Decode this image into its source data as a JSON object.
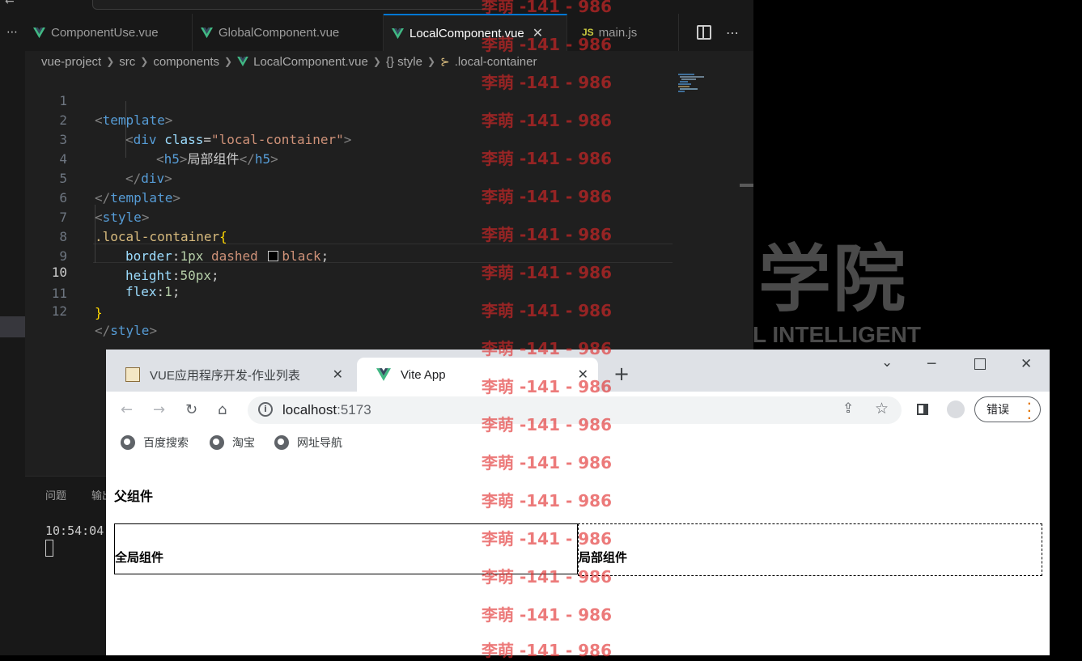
{
  "vscode": {
    "tabs": [
      {
        "label": "ComponentUse.vue",
        "icon": "vue-icon"
      },
      {
        "label": "GlobalComponent.vue",
        "icon": "vue-icon"
      },
      {
        "label": "LocalComponent.vue",
        "icon": "vue-icon",
        "active": true
      },
      {
        "label": "main.js",
        "icon": "js-icon"
      }
    ],
    "js_badge": "JS",
    "breadcrumb": [
      "vue-project",
      "src",
      "components",
      "LocalComponent.vue",
      "{} style",
      ".local-container"
    ],
    "code": {
      "l1": {
        "n": "1",
        "open": "<",
        "tag": "template",
        "close": ">"
      },
      "l2": {
        "n": "2",
        "open": "<",
        "tag": "div",
        "attr": "class",
        "eq": "=",
        "val": "\"local-container\"",
        "close": ">"
      },
      "l3": {
        "n": "3",
        "open": "<",
        "tag": "h5",
        "close": ">",
        "text": "局部组件",
        "open2": "</",
        "tag2": "h5",
        "close2": ">"
      },
      "l4": {
        "n": "4",
        "open": "</",
        "tag": "div",
        "close": ">"
      },
      "l5": {
        "n": "5",
        "open": "</",
        "tag": "template",
        "close": ">"
      },
      "l6": {
        "n": "6",
        "open": "<",
        "tag": "style",
        "close": ">"
      },
      "l7": {
        "n": "7",
        "selector": ".local-container",
        "brace": "{"
      },
      "l8": {
        "n": "8",
        "prop": "border",
        "colon": ":",
        "num": "1px",
        "val": "dashed",
        "color": "black",
        "semi": ";"
      },
      "l9": {
        "n": "9",
        "prop": "height",
        "colon": ":",
        "num": "50px",
        "semi": ";"
      },
      "l10": {
        "n": "10",
        "prop": "flex",
        "colon": ":",
        "num": "1",
        "semi": ";"
      },
      "l11": {
        "n": "11",
        "brace": "}"
      },
      "l12": {
        "n": "12",
        "open": "</",
        "tag": "style",
        "close": ">"
      }
    },
    "panel": {
      "tab1": "问题",
      "tab2": "输出",
      "terminal_time": "10:54:04"
    }
  },
  "background": {
    "big_text": "学院",
    "small_text": "L INTELLIGENT"
  },
  "chrome": {
    "tabs": [
      {
        "label": "VUE应用程序开发-作业列表",
        "icon": "site-favicon"
      },
      {
        "label": "Vite App",
        "icon": "vue-icon",
        "active": true
      }
    ],
    "new_tab": "+",
    "url_host": "localhost",
    "url_port": ":5173",
    "error_button": "错误",
    "bookmarks": [
      "百度搜索",
      "淘宝",
      "网址导航"
    ],
    "page": {
      "parent_heading": "父组件",
      "global_component": "全局组件",
      "local_component": "局部组件"
    }
  },
  "watermark": {
    "text": "李萌 -141 - 986"
  },
  "colors": {
    "vue_green": "#41b883",
    "editor_bg": "#1f1f1f",
    "accent": "#0078d4",
    "watermark": "#e02828"
  }
}
